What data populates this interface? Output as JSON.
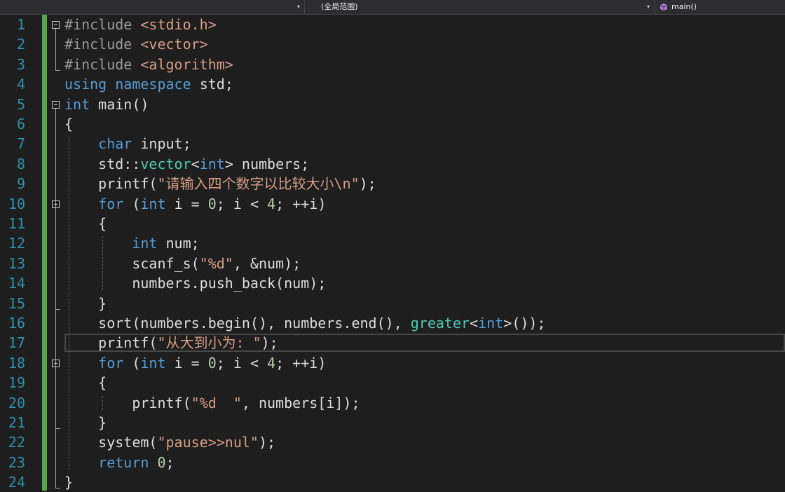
{
  "nav": {
    "project_dropdown": "",
    "scope_dropdown": "(全局范围)",
    "member_dropdown": "main()",
    "member_icon": "method-cube-icon",
    "caret": "▾"
  },
  "editor": {
    "line_numbers": [
      "1",
      "2",
      "3",
      "4",
      "5",
      "6",
      "7",
      "8",
      "9",
      "10",
      "11",
      "12",
      "13",
      "14",
      "15",
      "16",
      "17",
      "18",
      "19",
      "20",
      "21",
      "22",
      "23",
      "24"
    ],
    "current_line": 17,
    "lines": [
      {
        "code": "#include <stdio.h>"
      },
      {
        "code": "#include <vector>"
      },
      {
        "code": "#include <algorithm>"
      },
      {
        "code": "using namespace std;"
      },
      {
        "code": "int main()"
      },
      {
        "code": "{"
      },
      {
        "code": "    char input;"
      },
      {
        "code": "    std::vector<int> numbers;"
      },
      {
        "code": "    printf(\"请输入四个数字以比较大小\\n\");"
      },
      {
        "code": "    for (int i = 0; i < 4; ++i)"
      },
      {
        "code": "    {"
      },
      {
        "code": "        int num;"
      },
      {
        "code": "        scanf_s(\"%d\", &num);"
      },
      {
        "code": "        numbers.push_back(num);"
      },
      {
        "code": "    }"
      },
      {
        "code": "    sort(numbers.begin(), numbers.end(), greater<int>());"
      },
      {
        "code": "    printf(\"从大到小为: \");"
      },
      {
        "code": "    for (int i = 0; i < 4; ++i)"
      },
      {
        "code": "    {"
      },
      {
        "code": "        printf(\"%d  \", numbers[i]);"
      },
      {
        "code": "    }"
      },
      {
        "code": "    system(\"pause>>nul\");"
      },
      {
        "code": "    return 0;"
      },
      {
        "code": "}"
      }
    ]
  },
  "colors": {
    "background": "#1e1e1e",
    "line_number": "#2b91af",
    "keyword": "#569cd6",
    "preprocessor": "#9b9b9b",
    "string": "#d69d85",
    "number": "#b5cea8",
    "type": "#4ec9b0",
    "change_bar": "#57a64a"
  }
}
